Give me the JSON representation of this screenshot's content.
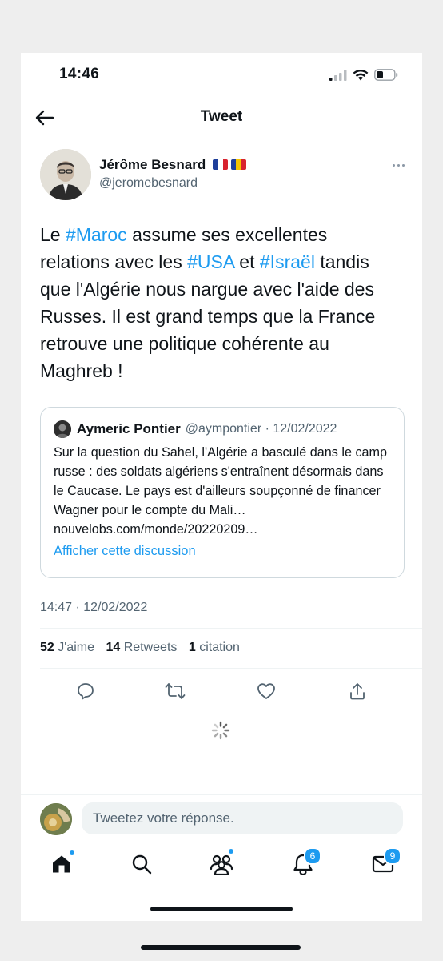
{
  "status": {
    "time": "14:46"
  },
  "nav": {
    "title": "Tweet"
  },
  "author": {
    "name": "Jérôme Besnard",
    "handle": "@jeromebesnard"
  },
  "tweet": {
    "segments": [
      {
        "t": "Le ",
        "tag": false
      },
      {
        "t": "#Maroc",
        "tag": true
      },
      {
        "t": " assume ses excellentes relations avec les ",
        "tag": false
      },
      {
        "t": "#USA",
        "tag": true
      },
      {
        "t": " et ",
        "tag": false
      },
      {
        "t": "#Israël",
        "tag": true
      },
      {
        "t": " tandis que l'Algérie nous nargue avec l'aide des Russes. Il est grand temps que la France  retrouve une politique cohérente au Maghreb !",
        "tag": false
      }
    ],
    "timestamp": "14:47 · 12/02/2022"
  },
  "quote": {
    "name": "Aymeric Pontier",
    "meta": "@aympontier · 12/02/2022",
    "body": "Sur la question du Sahel, l'Algérie a basculé dans le camp russe : des soldats algériens s'entraînent désormais dans le Caucase. Le pays est d'ailleurs soupçonné de financer Wagner pour le compte du Mali… nouvelobs.com/monde/20220209…",
    "link": "Afficher cette discussion"
  },
  "stats": {
    "likes_count": "52",
    "likes_label": "J'aime",
    "retweets_count": "14",
    "retweets_label": "Retweets",
    "quotes_count": "1",
    "quotes_label": "citation"
  },
  "reply": {
    "placeholder": "Tweetez votre réponse."
  },
  "tabbar": {
    "notifications_badge": "6",
    "messages_badge": "9"
  },
  "colors": {
    "accent": "#1d9bf0",
    "text": "#0f1419",
    "muted": "#536471"
  }
}
